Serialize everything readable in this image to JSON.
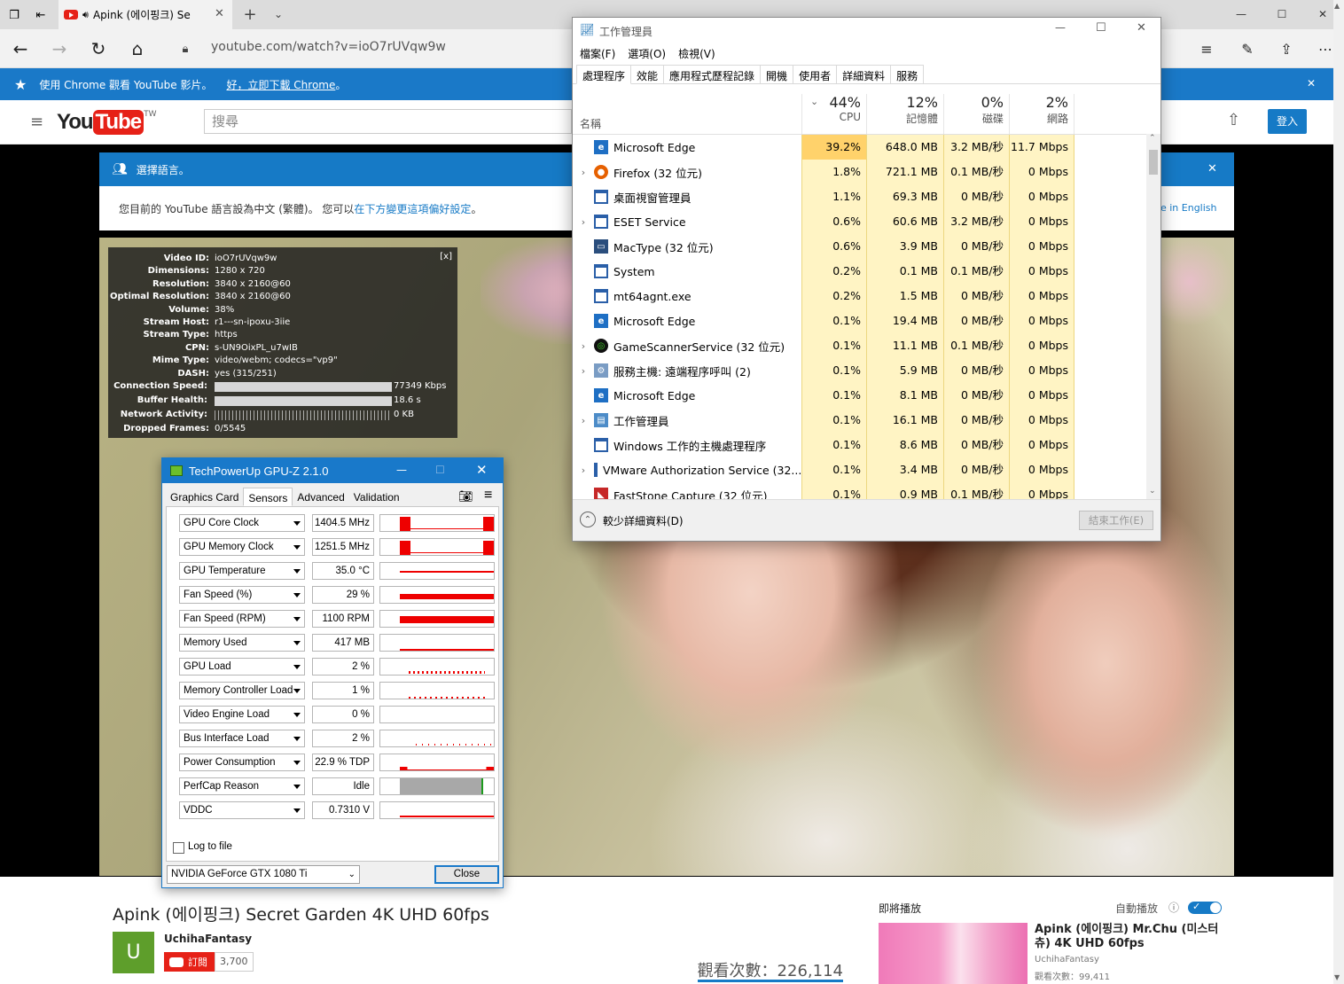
{
  "browser": {
    "tab_title": "Apink (에이핑크) Se",
    "address": "youtube.com/watch?v=ioO7rUVqw9w"
  },
  "chrome_banner": {
    "text": "使用 Chrome 觀看 YouTube 影片。",
    "link": "好，立即下載 Chrome",
    "suffix": "。"
  },
  "youtube": {
    "logo": "You",
    "logo_tube": "Tube",
    "region": "TW",
    "search_placeholder": "搜尋",
    "signin": "登入"
  },
  "lang_banner": {
    "title": "選擇語言。",
    "message": "您目前的 YouTube 語言設為中文 (繁體)。 您可以",
    "link": "在下方變更這項偏好設定",
    "suffix": "。",
    "english": "ge in English"
  },
  "stats": {
    "rows": [
      {
        "k": "Video ID:",
        "v": "ioO7rUVqw9w"
      },
      {
        "k": "Dimensions:",
        "v": "1280 x 720"
      },
      {
        "k": "Resolution:",
        "v": "3840 x 2160@60"
      },
      {
        "k": "Optimal Resolution:",
        "v": "3840 x 2160@60"
      },
      {
        "k": "Volume:",
        "v": "38%"
      },
      {
        "k": "Stream Host:",
        "v": "r1---sn-ipoxu-3iie"
      },
      {
        "k": "Stream Type:",
        "v": "https"
      },
      {
        "k": "CPN:",
        "v": "s-UN9OixPL_u7wIB"
      },
      {
        "k": "Mime Type:",
        "v": "video/webm; codecs=\"vp9\""
      },
      {
        "k": "DASH:",
        "v": "yes (315/251)"
      }
    ],
    "bars": [
      {
        "k": "Connection Speed:",
        "v": "77349 Kbps",
        "fill": 1.0
      },
      {
        "k": "Buffer Health:",
        "v": "18.6 s",
        "fill": 1.0
      },
      {
        "k": "Network Activity:",
        "v": "0 KB",
        "fill": 0.0
      }
    ],
    "dropped_k": "Dropped Frames:",
    "dropped_v": "0/5545",
    "close": "[x]"
  },
  "video_info": {
    "title": "Apink (에이핑크) Secret Garden 4K UHD 60fps",
    "channel": "UchihaFantasy",
    "avatar": "U",
    "subscribe": "訂閱",
    "subs": "3,700",
    "views": "觀看次數：226,114"
  },
  "upnext": {
    "label": "即將播放",
    "autoplay": "自動播放",
    "title": "Apink (에이핑크) Mr.Chu (미스터츄) 4K UHD 60fps",
    "channel": "UchihaFantasy",
    "views": "觀看次數：99,411"
  },
  "taskmgr": {
    "title": "工作管理員",
    "menu": [
      "檔案(F)",
      "選項(O)",
      "檢視(V)"
    ],
    "tabs": [
      "處理程序",
      "效能",
      "應用程式歷程記錄",
      "開機",
      "使用者",
      "詳細資料",
      "服務"
    ],
    "name_col": "名稱",
    "cols": [
      {
        "pct": "44%",
        "label": "CPU"
      },
      {
        "pct": "12%",
        "label": "記憶體"
      },
      {
        "pct": "0%",
        "label": "磁碟"
      },
      {
        "pct": "2%",
        "label": "網路"
      }
    ],
    "processes": [
      {
        "name": "Microsoft Edge",
        "cpu": "39.2%",
        "mem": "648.0 MB",
        "disk": "3.2 MB/秒",
        "net": "11.7 Mbps",
        "exp": false,
        "icon": "edge"
      },
      {
        "name": "Firefox (32 位元)",
        "cpu": "1.8%",
        "mem": "721.1 MB",
        "disk": "0.1 MB/秒",
        "net": "0 Mbps",
        "exp": true,
        "icon": "firefox"
      },
      {
        "name": "桌面視窗管理員",
        "cpu": "1.1%",
        "mem": "69.3 MB",
        "disk": "0 MB/秒",
        "net": "0 Mbps",
        "exp": false,
        "icon": "win"
      },
      {
        "name": "ESET Service",
        "cpu": "0.6%",
        "mem": "60.6 MB",
        "disk": "3.2 MB/秒",
        "net": "0 Mbps",
        "exp": true,
        "icon": "win"
      },
      {
        "name": "MacType (32 位元)",
        "cpu": "0.6%",
        "mem": "3.9 MB",
        "disk": "0 MB/秒",
        "net": "0 Mbps",
        "exp": false,
        "icon": "monitor"
      },
      {
        "name": "System",
        "cpu": "0.2%",
        "mem": "0.1 MB",
        "disk": "0.1 MB/秒",
        "net": "0 Mbps",
        "exp": false,
        "icon": "win"
      },
      {
        "name": "mt64agnt.exe",
        "cpu": "0.2%",
        "mem": "1.5 MB",
        "disk": "0 MB/秒",
        "net": "0 Mbps",
        "exp": false,
        "icon": "win"
      },
      {
        "name": "Microsoft Edge",
        "cpu": "0.1%",
        "mem": "19.4 MB",
        "disk": "0 MB/秒",
        "net": "0 Mbps",
        "exp": false,
        "icon": "edge"
      },
      {
        "name": "GameScannerService (32 位元)",
        "cpu": "0.1%",
        "mem": "11.1 MB",
        "disk": "0.1 MB/秒",
        "net": "0 Mbps",
        "exp": true,
        "icon": "razer"
      },
      {
        "name": "服務主機: 遠端程序呼叫 (2)",
        "cpu": "0.1%",
        "mem": "5.9 MB",
        "disk": "0 MB/秒",
        "net": "0 Mbps",
        "exp": true,
        "icon": "gear"
      },
      {
        "name": "Microsoft Edge",
        "cpu": "0.1%",
        "mem": "8.1 MB",
        "disk": "0 MB/秒",
        "net": "0 Mbps",
        "exp": false,
        "icon": "edge"
      },
      {
        "name": "工作管理員",
        "cpu": "0.1%",
        "mem": "16.1 MB",
        "disk": "0 MB/秒",
        "net": "0 Mbps",
        "exp": true,
        "icon": "tm"
      },
      {
        "name": "Windows 工作的主機處理程序",
        "cpu": "0.1%",
        "mem": "8.6 MB",
        "disk": "0 MB/秒",
        "net": "0 Mbps",
        "exp": false,
        "icon": "win"
      },
      {
        "name": "VMware Authorization Service (32...",
        "cpu": "0.1%",
        "mem": "3.4 MB",
        "disk": "0 MB/秒",
        "net": "0 Mbps",
        "exp": true,
        "icon": "win"
      },
      {
        "name": "FastStone Capture (32 位元)",
        "cpu": "0.1%",
        "mem": "0.9 MB",
        "disk": "0.1 MB/秒",
        "net": "0 Mbps",
        "exp": false,
        "icon": "fs"
      }
    ],
    "fewer": "較少詳細資料(D)",
    "end_task": "結束工作(E)"
  },
  "gpuz": {
    "title": "TechPowerUp GPU-Z 2.1.0",
    "tabs": [
      "Graphics Card",
      "Sensors",
      "Advanced",
      "Validation"
    ],
    "sensors": [
      {
        "name": "GPU Core Clock",
        "value": "1404.5 MHz"
      },
      {
        "name": "GPU Memory Clock",
        "value": "1251.5 MHz"
      },
      {
        "name": "GPU Temperature",
        "value": "35.0 °C"
      },
      {
        "name": "Fan Speed (%)",
        "value": "29 %"
      },
      {
        "name": "Fan Speed (RPM)",
        "value": "1100 RPM"
      },
      {
        "name": "Memory Used",
        "value": "417 MB"
      },
      {
        "name": "GPU Load",
        "value": "2 %"
      },
      {
        "name": "Memory Controller Load",
        "value": "1 %"
      },
      {
        "name": "Video Engine Load",
        "value": "0 %"
      },
      {
        "name": "Bus Interface Load",
        "value": "2 %"
      },
      {
        "name": "Power Consumption",
        "value": "22.9 % TDP"
      },
      {
        "name": "PerfCap Reason",
        "value": "Idle"
      },
      {
        "name": "VDDC",
        "value": "0.7310 V"
      }
    ],
    "log": "Log to file",
    "gpu": "NVIDIA GeForce GTX 1080 Ti",
    "close": "Close"
  }
}
